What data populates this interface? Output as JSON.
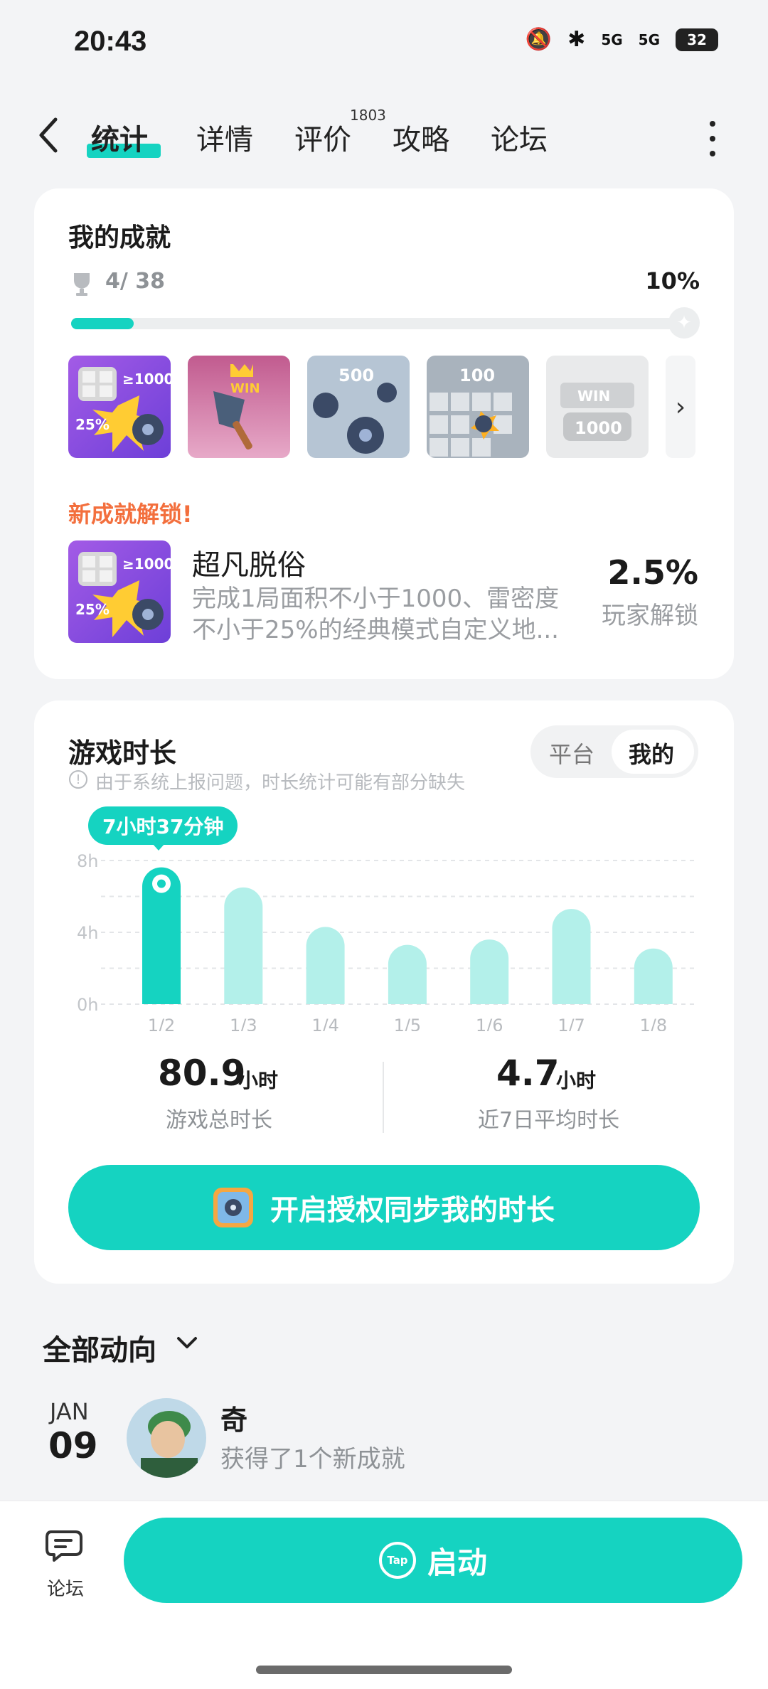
{
  "status_bar": {
    "time": "20:43",
    "network1": "5G",
    "network2": "5G",
    "battery": "32"
  },
  "nav": {
    "tabs": [
      {
        "label": "统计",
        "active": true
      },
      {
        "label": "详情"
      },
      {
        "label": "评价",
        "count": "1803"
      },
      {
        "label": "攻略"
      },
      {
        "label": "论坛"
      }
    ]
  },
  "achievements": {
    "title": "我的成就",
    "count": "4/ 38",
    "percent": "10%",
    "progress": 0.1,
    "badges": [
      {
        "name": "badge-1000-25",
        "text": "≥1000"
      },
      {
        "name": "badge-win-shovel",
        "text": "WIN"
      },
      {
        "name": "badge-500",
        "text": "500"
      },
      {
        "name": "badge-100",
        "text": "100"
      },
      {
        "name": "badge-win-1000-locked",
        "text": "WIN 1000"
      }
    ],
    "new_unlock_label": "新成就解锁!",
    "new_unlock": {
      "name": "超凡脱俗",
      "description": "完成1局面积不小于1000、雷密度不小于25%的经典模式自定义地...",
      "rate": "2.5%",
      "rate_label": "玩家解锁"
    }
  },
  "play_time": {
    "title": "游戏时长",
    "note": "由于系统上报问题，时长统计可能有部分缺失",
    "toggle": {
      "platform": "平台",
      "mine": "我的",
      "selected": "我的"
    },
    "tooltip": "7小时37分钟",
    "total_value": "80.9",
    "total_unit": "小时",
    "total_label": "游戏总时长",
    "avg_value": "4.7",
    "avg_unit": "小时",
    "avg_label": "近7日平均时长",
    "sync_button": "开启授权同步我的时长"
  },
  "chart_data": {
    "type": "bar",
    "categories": [
      "1/2",
      "1/3",
      "1/4",
      "1/5",
      "1/6",
      "1/7",
      "1/8"
    ],
    "values": [
      7.62,
      6.5,
      4.3,
      3.3,
      3.6,
      5.3,
      3.1
    ],
    "y_ticks": [
      "0h",
      "4h",
      "8h"
    ],
    "ylim": [
      0,
      8
    ],
    "highlight_index": 0,
    "colors": {
      "active": "#15d3c1",
      "inactive": "#b3f0ea"
    }
  },
  "activity": {
    "title": "全部动向",
    "month": "JAN",
    "day": "09",
    "user": "奇",
    "text": "获得了1个新成就"
  },
  "bottom_bar": {
    "forum_label": "论坛",
    "launch_label": "启动",
    "tap_text": "Tap"
  }
}
